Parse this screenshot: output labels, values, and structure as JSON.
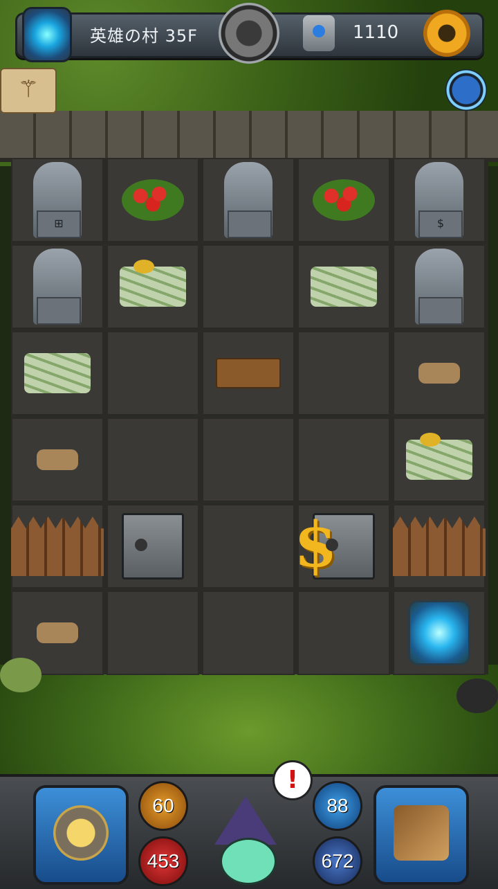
{
  "header": {
    "floor_title": "英雄の村 35F",
    "gem_count": "1110"
  },
  "board": {
    "cells": [
      {
        "row": 0,
        "col": 0,
        "item": "statue",
        "pedestal_symbol": "⊞"
      },
      {
        "row": 0,
        "col": 1,
        "item": "red-flower-bush"
      },
      {
        "row": 0,
        "col": 2,
        "item": "statue",
        "pedestal_symbol": ""
      },
      {
        "row": 0,
        "col": 3,
        "item": "red-flower-bush"
      },
      {
        "row": 0,
        "col": 4,
        "item": "statue",
        "pedestal_symbol": "$"
      },
      {
        "row": 1,
        "col": 0,
        "item": "hammer-statue"
      },
      {
        "row": 1,
        "col": 1,
        "item": "cash-pile-with-coins"
      },
      {
        "row": 1,
        "col": 3,
        "item": "cash-pile"
      },
      {
        "row": 1,
        "col": 4,
        "item": "slime-knight-statue"
      },
      {
        "row": 2,
        "col": 0,
        "item": "cash-pile"
      },
      {
        "row": 2,
        "col": 2,
        "item": "wooden-signpost"
      },
      {
        "row": 2,
        "col": 4,
        "item": "rocks"
      },
      {
        "row": 3,
        "col": 0,
        "item": "rocks"
      },
      {
        "row": 3,
        "col": 4,
        "item": "cash-pile-with-coins"
      },
      {
        "row": 4,
        "col": 0,
        "item": "fence"
      },
      {
        "row": 4,
        "col": 1,
        "item": "safe"
      },
      {
        "row": 4,
        "col": 3,
        "item": "safe-with-dollar"
      },
      {
        "row": 4,
        "col": 4,
        "item": "fence"
      },
      {
        "row": 5,
        "col": 0,
        "item": "rocks"
      },
      {
        "row": 5,
        "col": 4,
        "item": "exit-portal"
      }
    ]
  },
  "hud": {
    "attack": "60",
    "hp": "453",
    "defense": "88",
    "mp": "672",
    "alert_symbol": "!"
  },
  "icons": {
    "scroll_button": "⚚"
  },
  "colors": {
    "board_bg": "#3a3935",
    "gold": "#f2b71e",
    "hp_red": "#e03535",
    "defense_blue": "#3fa0e8"
  }
}
